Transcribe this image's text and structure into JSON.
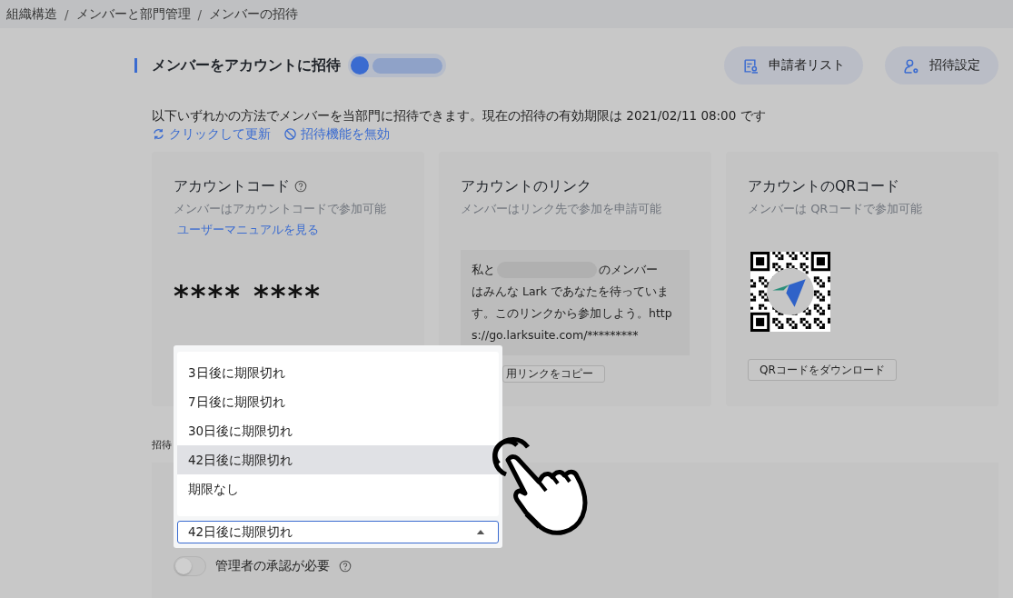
{
  "breadcrumb": [
    {
      "label": "組織構造",
      "separator": "/"
    },
    {
      "label": "メンバーと部門管理",
      "separator": "/"
    },
    {
      "label": "メンバーの招待"
    }
  ],
  "header": {
    "title": "メンバーをアカウントに招待",
    "buttons": [
      {
        "label": "申請者リスト"
      },
      {
        "label": "招待設定"
      }
    ]
  },
  "description": "以下いずれかの方法でメンバーを当部門に招待できます。現在の招待の有効期限は 2021/02/11 08:00 です",
  "actions": [
    {
      "label": "クリックして更新"
    },
    {
      "label": "招待機能を無効"
    }
  ],
  "cards": [
    {
      "kind": "code",
      "title": "アカウントコード",
      "help": true,
      "subtitle": "メンバーはアカウントコードで参加可能",
      "link": "ユーザーマニュアルを見る",
      "code": "**** ****"
    },
    {
      "kind": "link",
      "title": "アカウントのリンク",
      "help": false,
      "subtitle": "メンバーはリンク先で参加を申請可能",
      "message_start": "私と",
      "message_after": "のメンバー",
      "message_rest": "はみんな Lark であなたを待っています。このリンクから参加しよう。https://go.larksuite.com/*********",
      "button": "用リンクをコピー"
    },
    {
      "kind": "qr",
      "title": "アカウントのQRコード",
      "help": false,
      "subtitle": "メンバーは QRコードで参加可能",
      "button": "QRコードをダウンロード"
    }
  ],
  "settings": {
    "label": "招待",
    "approval_toggle": {
      "label": "管理者の承認が必要",
      "on": false
    }
  },
  "dropdown": {
    "value": "42日後に期限切れ",
    "options": [
      {
        "label": "3日後に期限切れ",
        "selected": false
      },
      {
        "label": "7日後に期限切れ",
        "selected": false
      },
      {
        "label": "30日後に期限切れ",
        "selected": false
      },
      {
        "label": "42日後に期限切れ",
        "selected": true
      },
      {
        "label": "期限なし",
        "selected": false
      }
    ]
  }
}
